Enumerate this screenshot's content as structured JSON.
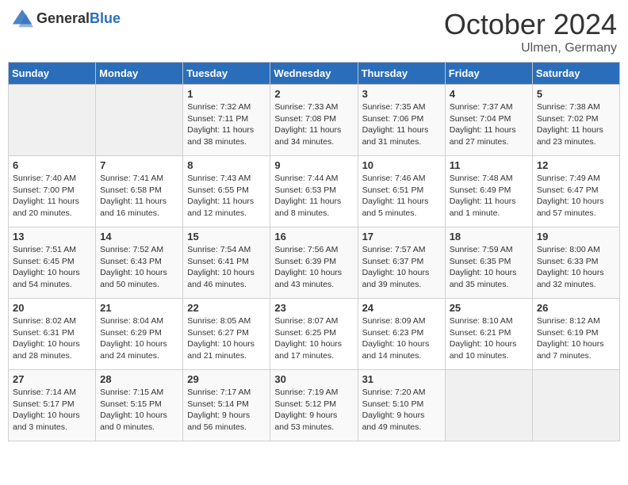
{
  "header": {
    "logo_general": "General",
    "logo_blue": "Blue",
    "month_title": "October 2024",
    "location": "Ulmen, Germany"
  },
  "days_of_week": [
    "Sunday",
    "Monday",
    "Tuesday",
    "Wednesday",
    "Thursday",
    "Friday",
    "Saturday"
  ],
  "weeks": [
    [
      {
        "day": "",
        "sunrise": "",
        "sunset": "",
        "daylight": "",
        "empty": true
      },
      {
        "day": "",
        "sunrise": "",
        "sunset": "",
        "daylight": "",
        "empty": true
      },
      {
        "day": "1",
        "sunrise": "Sunrise: 7:32 AM",
        "sunset": "Sunset: 7:11 PM",
        "daylight": "Daylight: 11 hours and 38 minutes."
      },
      {
        "day": "2",
        "sunrise": "Sunrise: 7:33 AM",
        "sunset": "Sunset: 7:08 PM",
        "daylight": "Daylight: 11 hours and 34 minutes."
      },
      {
        "day": "3",
        "sunrise": "Sunrise: 7:35 AM",
        "sunset": "Sunset: 7:06 PM",
        "daylight": "Daylight: 11 hours and 31 minutes."
      },
      {
        "day": "4",
        "sunrise": "Sunrise: 7:37 AM",
        "sunset": "Sunset: 7:04 PM",
        "daylight": "Daylight: 11 hours and 27 minutes."
      },
      {
        "day": "5",
        "sunrise": "Sunrise: 7:38 AM",
        "sunset": "Sunset: 7:02 PM",
        "daylight": "Daylight: 11 hours and 23 minutes."
      }
    ],
    [
      {
        "day": "6",
        "sunrise": "Sunrise: 7:40 AM",
        "sunset": "Sunset: 7:00 PM",
        "daylight": "Daylight: 11 hours and 20 minutes."
      },
      {
        "day": "7",
        "sunrise": "Sunrise: 7:41 AM",
        "sunset": "Sunset: 6:58 PM",
        "daylight": "Daylight: 11 hours and 16 minutes."
      },
      {
        "day": "8",
        "sunrise": "Sunrise: 7:43 AM",
        "sunset": "Sunset: 6:55 PM",
        "daylight": "Daylight: 11 hours and 12 minutes."
      },
      {
        "day": "9",
        "sunrise": "Sunrise: 7:44 AM",
        "sunset": "Sunset: 6:53 PM",
        "daylight": "Daylight: 11 hours and 8 minutes."
      },
      {
        "day": "10",
        "sunrise": "Sunrise: 7:46 AM",
        "sunset": "Sunset: 6:51 PM",
        "daylight": "Daylight: 11 hours and 5 minutes."
      },
      {
        "day": "11",
        "sunrise": "Sunrise: 7:48 AM",
        "sunset": "Sunset: 6:49 PM",
        "daylight": "Daylight: 11 hours and 1 minute."
      },
      {
        "day": "12",
        "sunrise": "Sunrise: 7:49 AM",
        "sunset": "Sunset: 6:47 PM",
        "daylight": "Daylight: 10 hours and 57 minutes."
      }
    ],
    [
      {
        "day": "13",
        "sunrise": "Sunrise: 7:51 AM",
        "sunset": "Sunset: 6:45 PM",
        "daylight": "Daylight: 10 hours and 54 minutes."
      },
      {
        "day": "14",
        "sunrise": "Sunrise: 7:52 AM",
        "sunset": "Sunset: 6:43 PM",
        "daylight": "Daylight: 10 hours and 50 minutes."
      },
      {
        "day": "15",
        "sunrise": "Sunrise: 7:54 AM",
        "sunset": "Sunset: 6:41 PM",
        "daylight": "Daylight: 10 hours and 46 minutes."
      },
      {
        "day": "16",
        "sunrise": "Sunrise: 7:56 AM",
        "sunset": "Sunset: 6:39 PM",
        "daylight": "Daylight: 10 hours and 43 minutes."
      },
      {
        "day": "17",
        "sunrise": "Sunrise: 7:57 AM",
        "sunset": "Sunset: 6:37 PM",
        "daylight": "Daylight: 10 hours and 39 minutes."
      },
      {
        "day": "18",
        "sunrise": "Sunrise: 7:59 AM",
        "sunset": "Sunset: 6:35 PM",
        "daylight": "Daylight: 10 hours and 35 minutes."
      },
      {
        "day": "19",
        "sunrise": "Sunrise: 8:00 AM",
        "sunset": "Sunset: 6:33 PM",
        "daylight": "Daylight: 10 hours and 32 minutes."
      }
    ],
    [
      {
        "day": "20",
        "sunrise": "Sunrise: 8:02 AM",
        "sunset": "Sunset: 6:31 PM",
        "daylight": "Daylight: 10 hours and 28 minutes."
      },
      {
        "day": "21",
        "sunrise": "Sunrise: 8:04 AM",
        "sunset": "Sunset: 6:29 PM",
        "daylight": "Daylight: 10 hours and 24 minutes."
      },
      {
        "day": "22",
        "sunrise": "Sunrise: 8:05 AM",
        "sunset": "Sunset: 6:27 PM",
        "daylight": "Daylight: 10 hours and 21 minutes."
      },
      {
        "day": "23",
        "sunrise": "Sunrise: 8:07 AM",
        "sunset": "Sunset: 6:25 PM",
        "daylight": "Daylight: 10 hours and 17 minutes."
      },
      {
        "day": "24",
        "sunrise": "Sunrise: 8:09 AM",
        "sunset": "Sunset: 6:23 PM",
        "daylight": "Daylight: 10 hours and 14 minutes."
      },
      {
        "day": "25",
        "sunrise": "Sunrise: 8:10 AM",
        "sunset": "Sunset: 6:21 PM",
        "daylight": "Daylight: 10 hours and 10 minutes."
      },
      {
        "day": "26",
        "sunrise": "Sunrise: 8:12 AM",
        "sunset": "Sunset: 6:19 PM",
        "daylight": "Daylight: 10 hours and 7 minutes."
      }
    ],
    [
      {
        "day": "27",
        "sunrise": "Sunrise: 7:14 AM",
        "sunset": "Sunset: 5:17 PM",
        "daylight": "Daylight: 10 hours and 3 minutes."
      },
      {
        "day": "28",
        "sunrise": "Sunrise: 7:15 AM",
        "sunset": "Sunset: 5:15 PM",
        "daylight": "Daylight: 10 hours and 0 minutes."
      },
      {
        "day": "29",
        "sunrise": "Sunrise: 7:17 AM",
        "sunset": "Sunset: 5:14 PM",
        "daylight": "Daylight: 9 hours and 56 minutes."
      },
      {
        "day": "30",
        "sunrise": "Sunrise: 7:19 AM",
        "sunset": "Sunset: 5:12 PM",
        "daylight": "Daylight: 9 hours and 53 minutes."
      },
      {
        "day": "31",
        "sunrise": "Sunrise: 7:20 AM",
        "sunset": "Sunset: 5:10 PM",
        "daylight": "Daylight: 9 hours and 49 minutes."
      },
      {
        "day": "",
        "sunrise": "",
        "sunset": "",
        "daylight": "",
        "empty": true
      },
      {
        "day": "",
        "sunrise": "",
        "sunset": "",
        "daylight": "",
        "empty": true
      }
    ]
  ]
}
